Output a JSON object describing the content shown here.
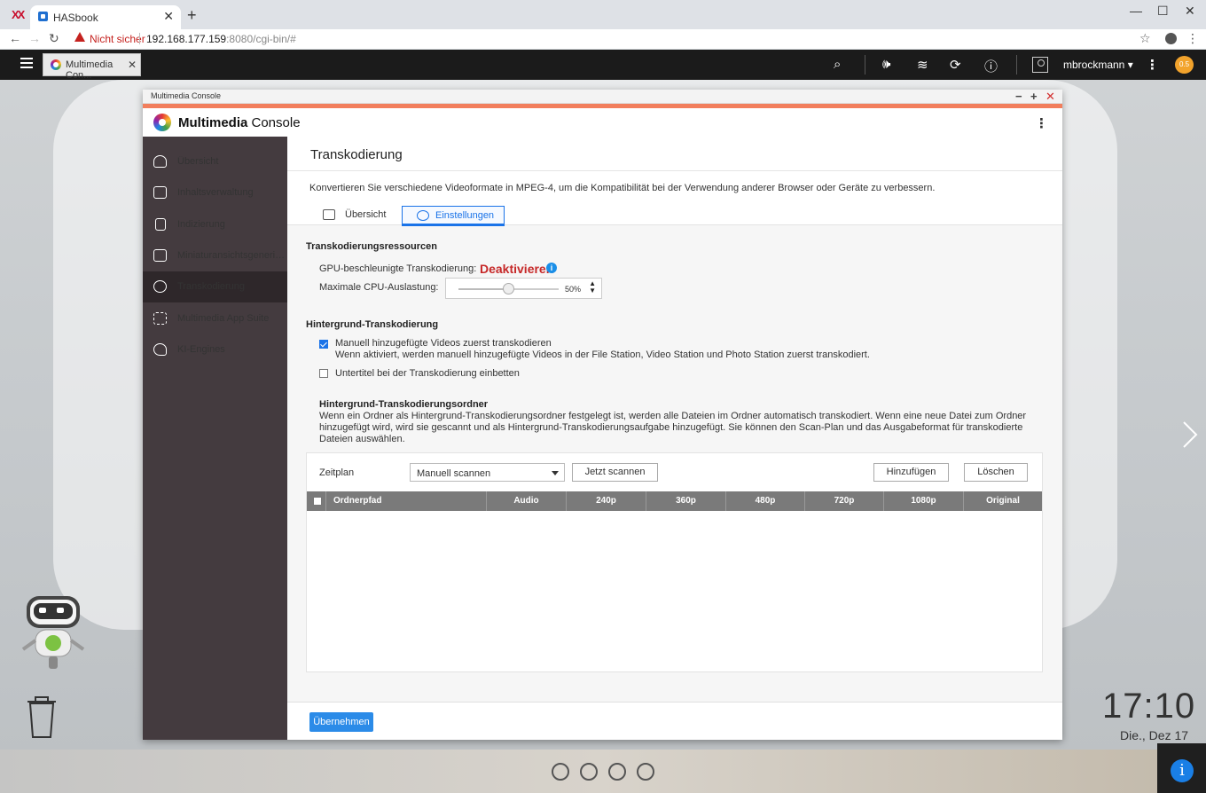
{
  "browser": {
    "tab_title": "HASbook",
    "not_secure": "Nicht sicher",
    "url_host": "192.168.177.159",
    "url_rest": ":8080/cgi-bin/#"
  },
  "qts": {
    "app_tab": "Multimedia Con...",
    "username": "mbrockmann ▾",
    "dashboard_value": "0.5"
  },
  "window": {
    "title": "Multimedia Console",
    "app_name_bold": "Multimedia",
    "app_name_rest": " Console"
  },
  "sidebar": {
    "items": [
      {
        "label": "Übersicht",
        "icon": "gauge-icon"
      },
      {
        "label": "Inhaltsverwaltung",
        "icon": "folder-search-icon"
      },
      {
        "label": "Indizierung",
        "icon": "clipboard-icon"
      },
      {
        "label": "Miniaturansichtsgenerierung",
        "icon": "image-icon"
      },
      {
        "label": "Transkodierung",
        "icon": "transcode-icon"
      },
      {
        "label": "Multimedia App Suite",
        "icon": "grid-icon"
      },
      {
        "label": "KI-Engines",
        "icon": "ai-head-icon"
      }
    ],
    "active_index": 4
  },
  "page": {
    "title": "Transkodierung",
    "description": "Konvertieren Sie verschiedene Videoformate in MPEG-4, um die Kompatibilität bei der Verwendung anderer Browser oder Geräte zu verbessern.",
    "tabs": [
      {
        "label": "Übersicht"
      },
      {
        "label": "Einstellungen"
      }
    ],
    "resources": {
      "heading": "Transkodierungsressourcen",
      "gpu_label": "GPU-beschleunigte Transkodierung:",
      "gpu_value": "Deaktivieren",
      "cpu_label": "Maximale CPU-Auslastung:",
      "cpu_value": "50%",
      "cpu_fraction": 0.5
    },
    "background": {
      "heading": "Hintergrund-Transkodierung",
      "opt1_label": "Manuell hinzugefügte Videos zuerst transkodieren",
      "opt1_desc": "Wenn aktiviert, werden manuell hinzugefügte Videos in der File Station, Video Station und Photo Station zuerst transkodiert.",
      "opt1_checked": true,
      "opt2_label": "Untertitel bei der Transkodierung einbetten",
      "opt2_checked": false
    },
    "folder": {
      "heading": "Hintergrund-Transkodierungsordner",
      "desc": "Wenn ein Ordner als Hintergrund-Transkodierungsordner festgelegt ist, werden alle Dateien im Ordner automatisch transkodiert. Wenn eine neue Datei zum Ordner hinzugefügt wird, wird sie gescannt und als Hintergrund-Transkodierungsaufgabe hinzugefügt. Sie können den Scan-Plan und das Ausgabeformat für transkodierte Dateien auswählen.",
      "schedule_label": "Zeitplan",
      "schedule_value": "Manuell scannen",
      "scan_now": "Jetzt scannen",
      "add": "Hinzufügen",
      "delete": "Löschen",
      "columns": [
        "Ordnerpfad",
        "Audio",
        "240p",
        "360p",
        "480p",
        "720p",
        "1080p",
        "Original"
      ]
    },
    "apply": "Übernehmen"
  },
  "desktop": {
    "time": "17:10",
    "date": "Die., Dez 17"
  },
  "colors": {
    "accent": "#f27e5c",
    "sidebar": "#443b3f",
    "primary": "#2b8be8",
    "danger": "#c62828"
  }
}
